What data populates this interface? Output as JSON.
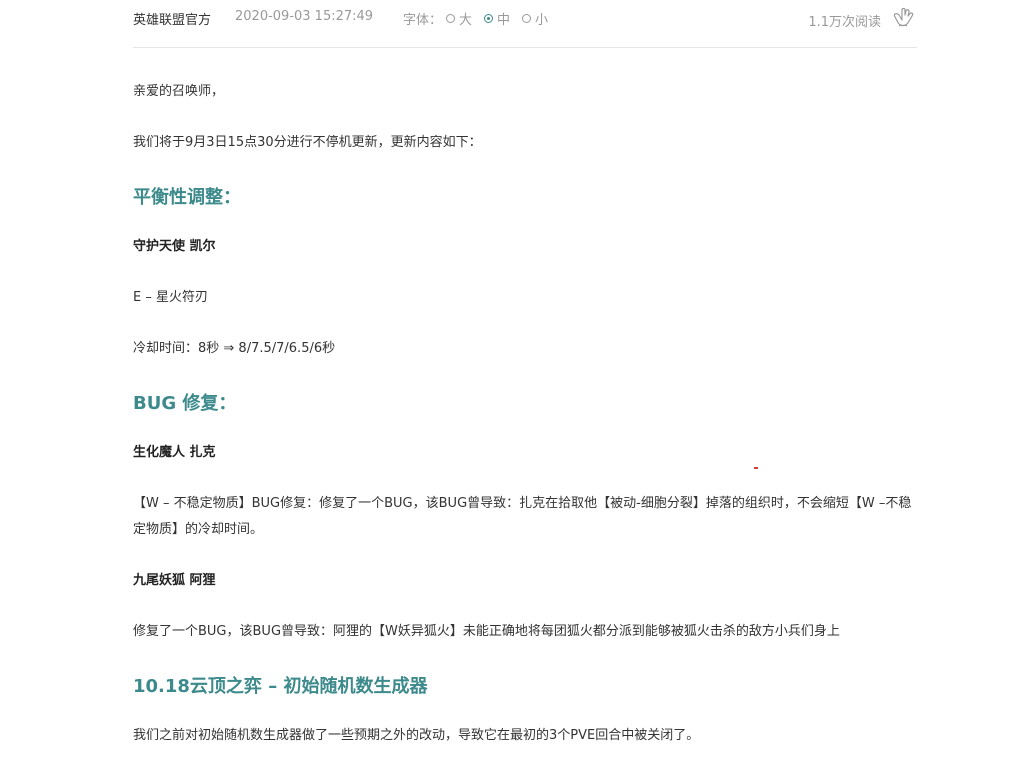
{
  "meta": {
    "author": "英雄联盟官方",
    "time": "2020-09-03 15:27:49",
    "font_size_label": "字体：",
    "font_options": [
      {
        "label": "大",
        "selected": false
      },
      {
        "label": "中",
        "selected": true
      },
      {
        "label": "小",
        "selected": false
      }
    ],
    "read_count": "1.1万次阅读",
    "like_icon": "hand-like-icon"
  },
  "article": {
    "greeting": "亲爱的召唤师，",
    "intro": "我们将于9月3日15点30分进行不停机更新，更新内容如下：",
    "section1": {
      "heading": "平衡性调整：",
      "champion": "守护天使 凯尔",
      "ability": "E – 星火符刃",
      "detail": "冷却时间：8秒 ⇒ 8/7.5/7/6.5/6秒"
    },
    "section2": {
      "heading": "BUG 修复：",
      "champion1": "生化魔人 扎克",
      "detail1": "【W – 不稳定物质】BUG修复：修复了一个BUG，该BUG曾导致：扎克在拾取他【被动-细胞分裂】掉落的组织时，不会缩短【W –不稳定物质】的冷却时间。",
      "champion2": "九尾妖狐 阿狸",
      "detail2": "修复了一个BUG，该BUG曾导致：阿狸的【W妖异狐火】未能正确地将每团狐火都分派到能够被狐火击杀的敌方小兵们身上"
    },
    "section3": {
      "heading": "10.18云顶之弈 – 初始随机数生成器",
      "detail": "我们之前对初始随机数生成器做了一些预期之外的改动，导致它在最初的3个PVE回合中被关闭了。"
    }
  },
  "colors": {
    "accent": "#3d8a8c",
    "text": "#333333",
    "muted": "#999999"
  }
}
